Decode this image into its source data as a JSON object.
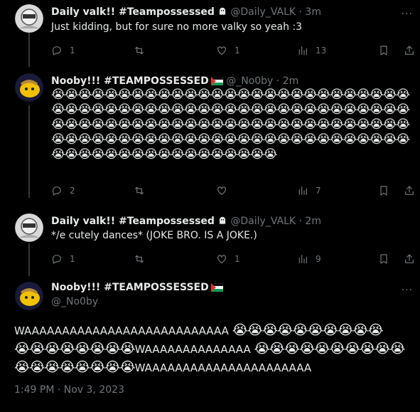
{
  "tweets": [
    {
      "name": "Daily valk!! #Teampossessed",
      "handle": "@Daily_VALK",
      "sep": "·",
      "time": "3m",
      "text": "Just kidding, but for sure no more valky so yeah :3",
      "replies": "1",
      "retweets": "",
      "likes": "1",
      "views": "13"
    },
    {
      "name": "Nooby!!! #TEAMPOSSESSED",
      "handle": "@_No0by",
      "sep": "·",
      "time": "2m",
      "text": "😭😭😭😭😭😭😭😭😭😭😭😭😭😭😭😭😭😭😭😭😭😭😭😭😭😭😭😭😭😭😭😭😭😭😭😭😭😭😭😭😭😭😭😭😭😭😭😭😭😭😭😭😭😭😭😭😭😭😭😭😭😭😭😭😭😭😭😭😭😭😭😭😭😭😭😭😭😭😭😭😭😭😭😭😭😭😭😭😭😭😭😭😭😭😭😭😭😭😭😭😭😭😭😭😭😭😭😭😭😭😭😭😭😭😭😭😭😭😭😭😭😭😭😭😭",
      "replies": "2",
      "retweets": "",
      "likes": "",
      "views": "7"
    },
    {
      "name": "Daily valk!! #Teampossessed",
      "handle": "@Daily_VALK",
      "sep": "·",
      "time": "2m",
      "text": "*/e cutely dances* (JOKE BRO. IS A JOKE.)",
      "replies": "1",
      "retweets": "",
      "likes": "1",
      "views": "9"
    }
  ],
  "main_tweet": {
    "name": "Nooby!!! #TEAMPOSSESSED",
    "handle": "@_No0by",
    "line1_text": "WAAAAAAAAAAAAAAAAAAAAAAAAAAA ",
    "line1_emoji": "😭😭😭😭😭😭😭😭😭😭",
    "line2_emoji_a": "😭😭😭😭😭😭😭😭",
    "line2_text": "WAAAAAAAAAAAAAA ",
    "line2_emoji_b": "😭😭😭😭😭😭😭😭😭😭",
    "line3_emoji": "😭😭😭😭😭😭😭😭",
    "line3_text": "WAAAAAAAAAAAAAAAAAAAAAA",
    "timestamp": "1:49 PM · Nov 3, 2023"
  },
  "colors": {
    "background": "#000000",
    "text": "#e7e9ea",
    "muted": "#71767b",
    "thread_line": "#333639"
  },
  "icons": [
    "reply-icon",
    "retweet-icon",
    "like-icon",
    "views-icon",
    "bookmark-icon",
    "share-icon",
    "ghost-icon",
    "palestine-flag-icon",
    "more-icon"
  ]
}
